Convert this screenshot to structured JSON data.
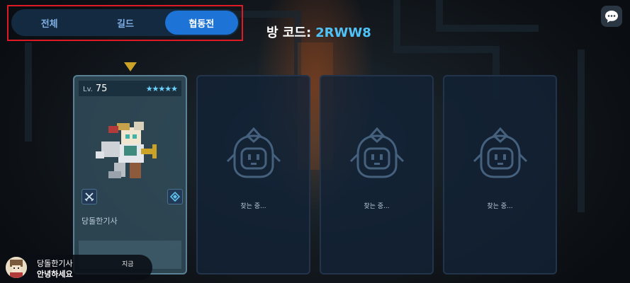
{
  "tabs": [
    {
      "label": "전체",
      "active": false
    },
    {
      "label": "길드",
      "active": false
    },
    {
      "label": "협동전",
      "active": true
    }
  ],
  "room": {
    "label": "방 코드:",
    "code": "2RWW8"
  },
  "player_card": {
    "level_prefix": "Lv.",
    "level": "75",
    "stars": "★★★★★",
    "name": "당돌한기사"
  },
  "empty_slots": [
    {
      "status": "찾는 중..."
    },
    {
      "status": "찾는 중..."
    },
    {
      "status": "찾는 중..."
    }
  ],
  "chat": {
    "name": "당돌한기사",
    "message": "안녕하세요",
    "time": "지금"
  },
  "colors": {
    "accent": "#1e74d6",
    "code": "#4fc3f7",
    "highlight": "#e01a24",
    "stars": "#6fd3ff"
  },
  "icons": {
    "chat": "chat-bubble-icon",
    "marker": "triangle-marker-icon",
    "job": "crossed-swords-icon",
    "role": "diamond-emblem-icon",
    "empty": "robot-placeholder-icon"
  }
}
